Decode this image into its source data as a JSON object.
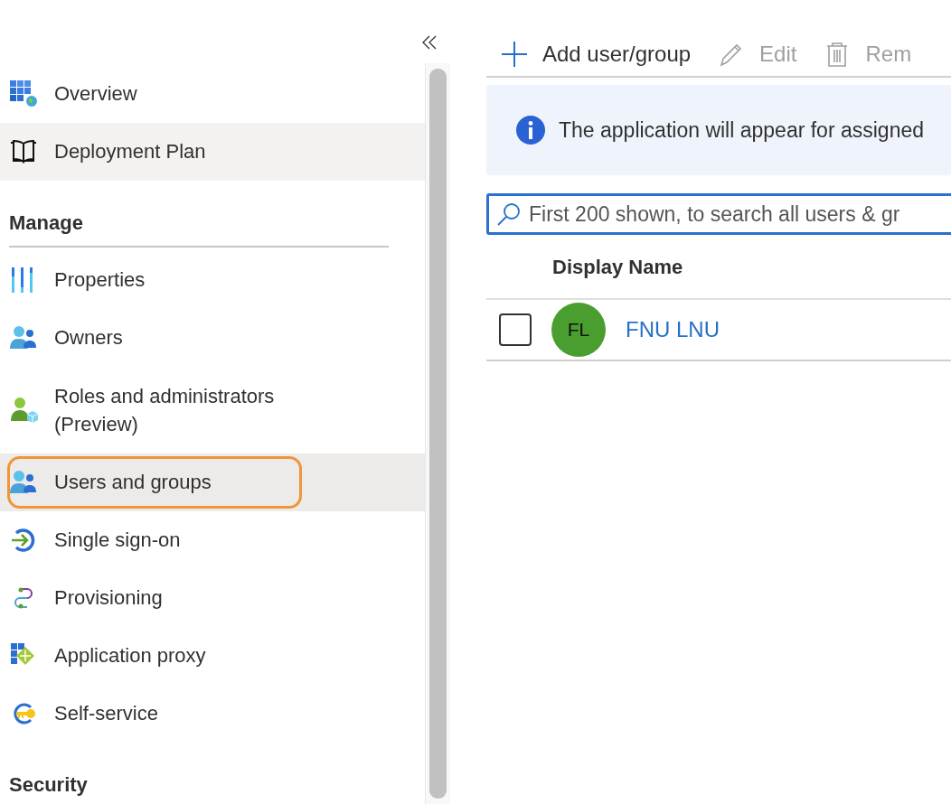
{
  "sidebar": {
    "sections": [
      {
        "items": [
          {
            "label": "Overview",
            "selected": false,
            "hovered": false,
            "outlined": false
          },
          {
            "label": "Deployment Plan",
            "selected": false,
            "hovered": true,
            "outlined": false
          }
        ]
      },
      {
        "heading": "Manage",
        "items": [
          {
            "label": "Properties",
            "selected": false,
            "hovered": false,
            "outlined": false
          },
          {
            "label": "Owners",
            "selected": false,
            "hovered": false,
            "outlined": false
          },
          {
            "label": "Roles and administrators (Preview)",
            "selected": false,
            "hovered": false,
            "outlined": false
          },
          {
            "label": "Users and groups",
            "selected": true,
            "hovered": false,
            "outlined": true
          },
          {
            "label": "Single sign-on",
            "selected": false,
            "hovered": false,
            "outlined": false
          },
          {
            "label": "Provisioning",
            "selected": false,
            "hovered": false,
            "outlined": false
          },
          {
            "label": "Application proxy",
            "selected": false,
            "hovered": false,
            "outlined": false
          },
          {
            "label": "Self-service",
            "selected": false,
            "hovered": false,
            "outlined": false
          }
        ]
      },
      {
        "heading": "Security"
      }
    ]
  },
  "toolbar": [
    {
      "label": "Add user/group",
      "disabled": false
    },
    {
      "label": "Edit",
      "disabled": true
    },
    {
      "label": "Rem",
      "disabled": true
    }
  ],
  "info_banner": {
    "text": "The application will appear for assigned"
  },
  "search": {
    "placeholder": "First 200 shown, to search all users & gr"
  },
  "table": {
    "columns": [
      "Display Name"
    ],
    "rows": [
      {
        "initials": "FL",
        "name": "FNU LNU",
        "checked": false
      }
    ]
  }
}
